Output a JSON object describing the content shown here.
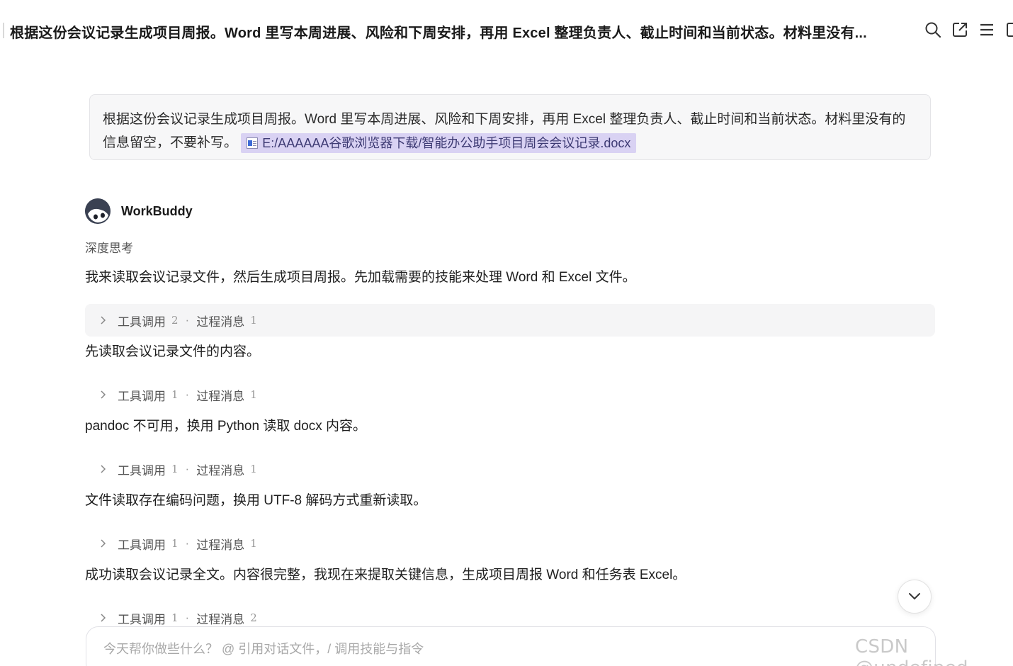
{
  "header": {
    "title": "根据这份会议记录生成项目周报。Word 里写本周进展、风险和下周安排，再用 Excel 整理负责人、截止时间和当前状态。材料里没有...",
    "icons": [
      "search-icon",
      "export-icon",
      "menu-icon",
      "panel-icon"
    ]
  },
  "user_message": {
    "text": "根据这份会议记录生成项目周报。Word 里写本周进展、风险和下周安排，再用 Excel 整理负责人、截止时间和当前状态。材料里没有的信息留空，不要补写。",
    "attachment": "E:/AAAAAA谷歌浏览器下载/智能办公助手项目周会会议记录.docx"
  },
  "assistant": {
    "name": "WorkBuddy",
    "thinking_label": "深度思考",
    "steps": [
      {
        "text": "我来读取会议记录文件，然后生成项目周报。先加载需要的技能来处理 Word 和 Excel 文件。",
        "tool_label": "工具调用",
        "tool_count": "2",
        "msg_label": "过程消息",
        "msg_count": "1"
      },
      {
        "text": "先读取会议记录文件的内容。",
        "tool_label": "工具调用",
        "tool_count": "1",
        "msg_label": "过程消息",
        "msg_count": "1"
      },
      {
        "text": "pandoc 不可用，换用 Python 读取 docx 内容。",
        "tool_label": "工具调用",
        "tool_count": "1",
        "msg_label": "过程消息",
        "msg_count": "1"
      },
      {
        "text": "文件读取存在编码问题，换用 UTF-8 解码方式重新读取。",
        "tool_label": "工具调用",
        "tool_count": "1",
        "msg_label": "过程消息",
        "msg_count": "1"
      },
      {
        "text": "成功读取会议记录全文。内容很完整，我现在来提取关键信息，生成项目周报 Word 和任务表 Excel。",
        "tool_label": "工具调用",
        "tool_count": "1",
        "msg_label": "过程消息",
        "msg_count": "2"
      }
    ]
  },
  "input": {
    "placeholder": "今天帮你做些什么？ @ 引用对话文件，/ 调用技能与指令"
  },
  "watermark": "CSDN @undefined",
  "colors": {
    "attachment_bg": "#d9d2f3",
    "user_bubble_bg": "#f7f7f8",
    "tool_row_highlight": "#f5f5f6"
  }
}
